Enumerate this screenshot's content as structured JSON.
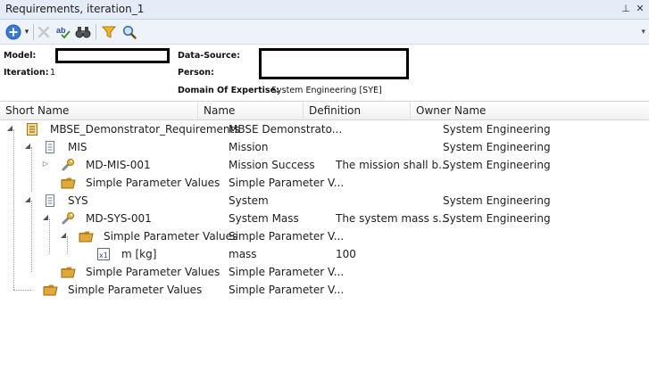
{
  "window": {
    "title": "Requirements, iteration_1",
    "pin_glyph": "⊥",
    "close_glyph": "✕"
  },
  "toolbar": {
    "add_icon": "add-circle-icon",
    "dropdown_glyph": "▾",
    "overflow_glyph": "▾"
  },
  "info": {
    "model_label": "Model:",
    "iteration_label": "Iteration:",
    "iteration_value": "1",
    "datasource_label": "Data-Source:",
    "person_label": "Person:",
    "domain_label": "Domain Of Expertise:",
    "domain_value": "System Engineering [SYE]"
  },
  "grid": {
    "columns": [
      "Short Name",
      "Name",
      "Definition",
      "Owner Name"
    ],
    "rows": [
      {
        "short": "MBSE_Demonstrator_Requirements",
        "name": "MBSE Demonstrato...",
        "definition": "",
        "owner": "System Engineering",
        "icon": "document-icon"
      },
      {
        "short": "MIS",
        "name": "Mission",
        "definition": "",
        "owner": "System Engineering",
        "icon": "list-icon"
      },
      {
        "short": "MD-MIS-001",
        "name": "Mission Success",
        "definition": "The mission shall b...",
        "owner": "System Engineering",
        "icon": "wrench-icon"
      },
      {
        "short": "Simple Parameter Values",
        "name": "Simple Parameter V...",
        "definition": "",
        "owner": "",
        "icon": "folder-icon"
      },
      {
        "short": "SYS",
        "name": "System",
        "definition": "",
        "owner": "System Engineering",
        "icon": "list-icon"
      },
      {
        "short": "MD-SYS-001",
        "name": "System Mass",
        "definition": "The system mass s...",
        "owner": "System Engineering",
        "icon": "wrench-icon"
      },
      {
        "short": "Simple Parameter Values",
        "name": "Simple Parameter V...",
        "definition": "",
        "owner": "",
        "icon": "folder-icon"
      },
      {
        "short": "m [kg]",
        "name": "mass",
        "definition": "100",
        "owner": "",
        "icon": "parameter-icon"
      },
      {
        "short": "Simple Parameter Values",
        "name": "Simple Parameter V...",
        "definition": "",
        "owner": "",
        "icon": "folder-icon"
      },
      {
        "short": "Simple Parameter Values",
        "name": "Simple Parameter V...",
        "definition": "",
        "owner": "",
        "icon": "folder-icon"
      }
    ]
  },
  "colors": {
    "accent": "#3a7bd5",
    "folder": "#e2a83a",
    "wrench": "#e8b23c",
    "header_bg": "#e3ecf7"
  }
}
